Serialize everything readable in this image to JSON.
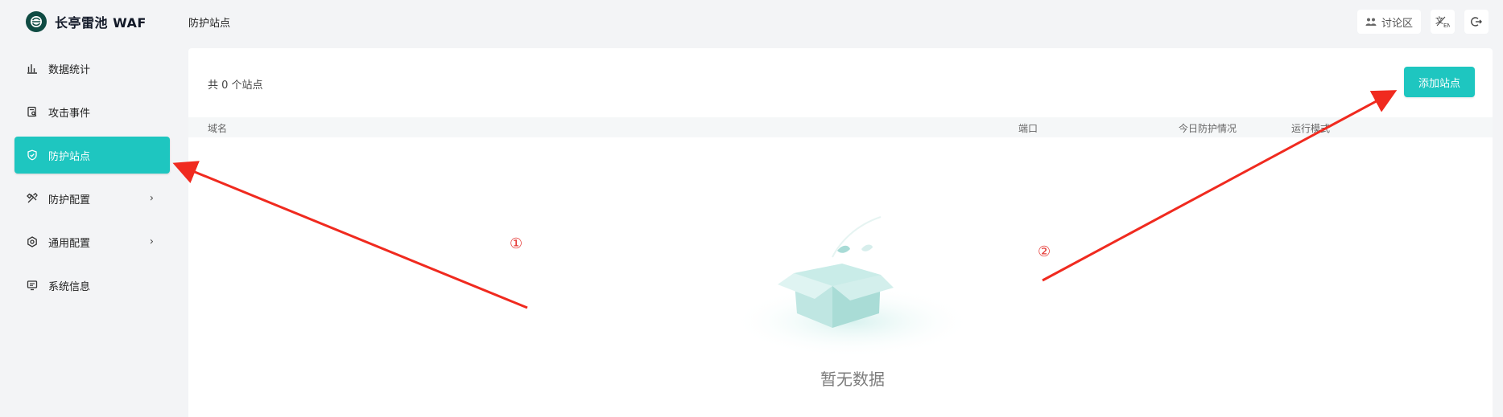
{
  "app": {
    "title": "长亭雷池 WAF",
    "brand_color": "#0f4b43",
    "accent_color": "#1ec6c0"
  },
  "sidebar": {
    "items": [
      {
        "label": "数据统计",
        "icon": "bar-chart-icon",
        "active": false,
        "has_children": false
      },
      {
        "label": "攻击事件",
        "icon": "document-search-icon",
        "active": false,
        "has_children": false
      },
      {
        "label": "防护站点",
        "icon": "shield-icon",
        "active": true,
        "has_children": false
      },
      {
        "label": "防护配置",
        "icon": "tools-icon",
        "active": false,
        "has_children": true
      },
      {
        "label": "通用配置",
        "icon": "settings-icon",
        "active": false,
        "has_children": true
      },
      {
        "label": "系统信息",
        "icon": "monitor-icon",
        "active": false,
        "has_children": false
      }
    ]
  },
  "header": {
    "breadcrumb": "防护站点",
    "forum_label": "讨论区",
    "language_icon": "language-toggle-icon",
    "logout_icon": "logout-icon"
  },
  "main": {
    "count_text": "共 0 个站点",
    "add_site_label": "添加站点",
    "columns": [
      "域名",
      "端口",
      "今日防护情况",
      "运行模式"
    ],
    "empty_text": "暂无数据"
  },
  "annotations": {
    "marker_1": "①",
    "marker_2": "②",
    "color": "#f02a1f"
  }
}
